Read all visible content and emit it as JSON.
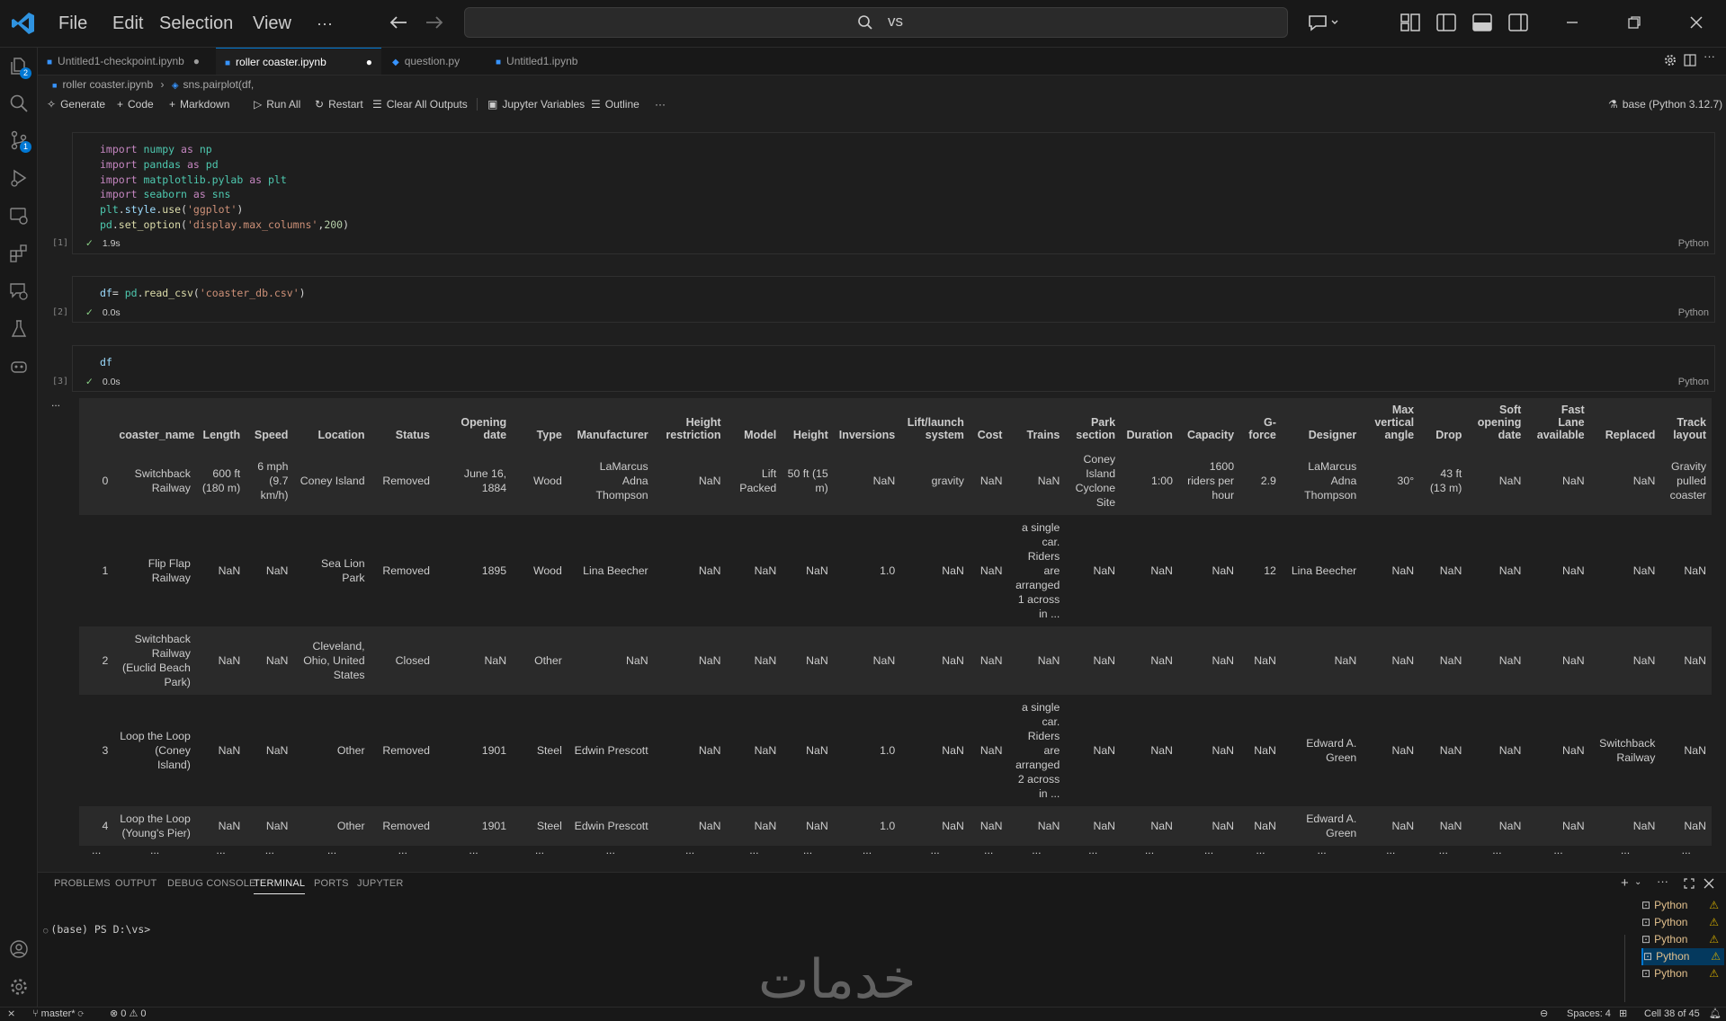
{
  "menu": [
    "File",
    "Edit",
    "Selection",
    "View",
    "···"
  ],
  "command_center": {
    "query": "vs"
  },
  "activity_badges": {
    "explorer": "2",
    "scm": "1"
  },
  "tabs": [
    {
      "label": "Untitled1-checkpoint.ipynb",
      "dirty": true,
      "active": false
    },
    {
      "label": "roller coaster.ipynb",
      "dirty": true,
      "active": true
    },
    {
      "label": "question.py",
      "dirty": false,
      "active": false
    },
    {
      "label": "Untitled1.ipynb",
      "dirty": false,
      "active": false
    }
  ],
  "breadcrumb": {
    "file": "roller coaster.ipynb",
    "symbol": "sns.pairplot(df,"
  },
  "notebook_toolbar": {
    "generate": "Generate",
    "code": "Code",
    "markdown": "Markdown",
    "run_all": "Run All",
    "restart": "Restart",
    "clear_outputs": "Clear All Outputs",
    "variables": "Jupyter Variables",
    "outline": "Outline",
    "more": "···",
    "kernel": "base (Python 3.12.7)"
  },
  "cells": [
    {
      "exec": "[1]",
      "time": "1.9s",
      "lang": "Python"
    },
    {
      "exec": "[2]",
      "time": "0.0s",
      "lang": "Python"
    },
    {
      "exec": "[3]",
      "time": "0.0s",
      "lang": "Python"
    }
  ],
  "output_more": "...",
  "dataframe": {
    "columns": [
      "",
      "coaster_name",
      "Length",
      "Speed",
      "Location",
      "Status",
      "Opening date",
      "Type",
      "Manufacturer",
      "Height restriction",
      "Model",
      "Height",
      "Inversions",
      "Lift/launch system",
      "Cost",
      "Trains",
      "Park section",
      "Duration",
      "Capacity",
      "G-force",
      "Designer",
      "Max vertical angle",
      "Drop",
      "Soft opening date",
      "Fast Lane available",
      "Replaced",
      "Track layout"
    ],
    "rows": [
      [
        "0",
        "Switchback Railway",
        "600 ft (180 m)",
        "6 mph (9.7 km/h)",
        "Coney Island",
        "Removed",
        "June 16, 1884",
        "Wood",
        "LaMarcus Adna Thompson",
        "NaN",
        "Lift Packed",
        "50 ft (15 m)",
        "NaN",
        "gravity",
        "NaN",
        "NaN",
        "Coney Island Cyclone Site",
        "1:00",
        "1600 riders per hour",
        "2.9",
        "LaMarcus Adna Thompson",
        "30°",
        "43 ft (13 m)",
        "NaN",
        "NaN",
        "NaN",
        "Gravity pulled coaster"
      ],
      [
        "1",
        "Flip Flap Railway",
        "NaN",
        "NaN",
        "Sea Lion Park",
        "Removed",
        "1895",
        "Wood",
        "Lina Beecher",
        "NaN",
        "NaN",
        "NaN",
        "1.0",
        "NaN",
        "NaN",
        "a single car. Riders are arranged 1 across in ...",
        "NaN",
        "NaN",
        "NaN",
        "12",
        "Lina Beecher",
        "NaN",
        "NaN",
        "NaN",
        "NaN",
        "NaN",
        "NaN"
      ],
      [
        "2",
        "Switchback Railway (Euclid Beach Park)",
        "NaN",
        "NaN",
        "Cleveland, Ohio, United States",
        "Closed",
        "NaN",
        "Other",
        "NaN",
        "NaN",
        "NaN",
        "NaN",
        "NaN",
        "NaN",
        "NaN",
        "NaN",
        "NaN",
        "NaN",
        "NaN",
        "NaN",
        "NaN",
        "NaN",
        "NaN",
        "NaN",
        "NaN",
        "NaN",
        "NaN"
      ],
      [
        "3",
        "Loop the Loop (Coney Island)",
        "NaN",
        "NaN",
        "Other",
        "Removed",
        "1901",
        "Steel",
        "Edwin Prescott",
        "NaN",
        "NaN",
        "NaN",
        "1.0",
        "NaN",
        "NaN",
        "a single car. Riders are arranged 2 across in ...",
        "NaN",
        "NaN",
        "NaN",
        "NaN",
        "Edward A. Green",
        "NaN",
        "NaN",
        "NaN",
        "NaN",
        "Switchback Railway",
        "NaN"
      ],
      [
        "4",
        "Loop the Loop (Young's Pier)",
        "NaN",
        "NaN",
        "Other",
        "Removed",
        "1901",
        "Steel",
        "Edwin Prescott",
        "NaN",
        "NaN",
        "NaN",
        "1.0",
        "NaN",
        "NaN",
        "NaN",
        "NaN",
        "NaN",
        "NaN",
        "NaN",
        "Edward A. Green",
        "NaN",
        "NaN",
        "NaN",
        "NaN",
        "NaN",
        "NaN"
      ]
    ],
    "ellipsis": "..."
  },
  "panel": {
    "tabs": [
      "PROBLEMS",
      "OUTPUT",
      "DEBUG CONSOLE",
      "TERMINAL",
      "PORTS",
      "JUPYTER"
    ],
    "active_tab": "TERMINAL",
    "prompt": "(base) PS D:\\vs>",
    "terminals": [
      "Python",
      "Python",
      "Python",
      "Python",
      "Python"
    ]
  },
  "statusbar": {
    "branch": "master*",
    "errors": "0",
    "warnings": "0",
    "spaces": "Spaces: 4",
    "cell": "Cell 38 of 45"
  },
  "watermark": "خدمات",
  "colors": {
    "accent": "#0078d4",
    "check": "#89d185",
    "warning": "#cca700",
    "badge": "#0078d4"
  }
}
